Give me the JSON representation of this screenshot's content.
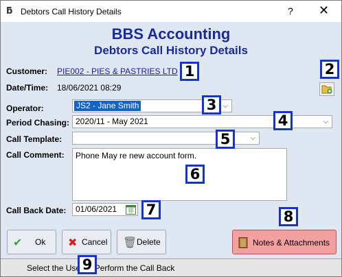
{
  "window": {
    "title": "Debtors Call History Details",
    "help": "?",
    "close": "✕"
  },
  "header": {
    "company": "BBS Accounting",
    "subtitle": "Debtors Call History Details"
  },
  "customer": {
    "label": "Customer:",
    "value": "PIE002 - PIES & PASTRIES LTD"
  },
  "datetime": {
    "label": "Date/Time:",
    "value": "18/06/2021 08:29"
  },
  "operator": {
    "label": "Operator:",
    "value": "JS2 - Jane Smith"
  },
  "period": {
    "label": "Period Chasing:",
    "value": "2020/11 - May 2021"
  },
  "template": {
    "label": "Call Template:",
    "value": ""
  },
  "comment": {
    "label": "Call Comment:",
    "value": "Phone May re new account form."
  },
  "callback": {
    "label": "Call Back Date:",
    "value": "01/06/2021"
  },
  "buttons": {
    "ok": "Ok",
    "cancel": "Cancel",
    "delete": "Delete",
    "notes": "Notes & Attachments"
  },
  "status": {
    "text": "Select the User to Perform the Call Back"
  },
  "badges": [
    "1",
    "2",
    "3",
    "4",
    "5",
    "6",
    "7",
    "8",
    "9"
  ],
  "icons": {
    "app": "bbs-logo-icon",
    "add_attachment": "add-document-icon",
    "calendar": "calendar-icon",
    "ok": "checkmark-icon",
    "cancel": "x-icon",
    "delete": "trash-icon",
    "notes": "notebook-icon"
  },
  "colors": {
    "heading": "#1a2a9a",
    "badge_border": "#1434d0",
    "notes_button": "#f4a0a0",
    "background": "#dfe7f3",
    "selected": "#1464c8"
  }
}
